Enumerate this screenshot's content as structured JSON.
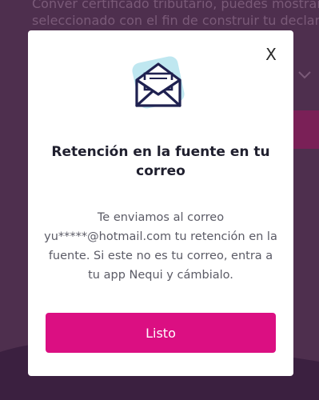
{
  "background": {
    "text_lines": [
      "Conver certificado tributario, puedes mostrar",
      "seleccionado con el fin de construir tu declara"
    ]
  },
  "modal": {
    "close_label": "X",
    "title": "Retención en la fuente en tu correo",
    "message": "Te enviamos al correo yu*****@hotmail.com tu retención en la fuente. Si este no es tu correo, entra a tu app Nequi y cámbialo.",
    "primary_button_label": "Listo",
    "icon": "envelope-letter-icon"
  },
  "colors": {
    "overlay": "#4e2f4e",
    "primary": "#db0f82",
    "icon_bg": "#bfe7f0",
    "icon_stroke": "#1f2150"
  }
}
